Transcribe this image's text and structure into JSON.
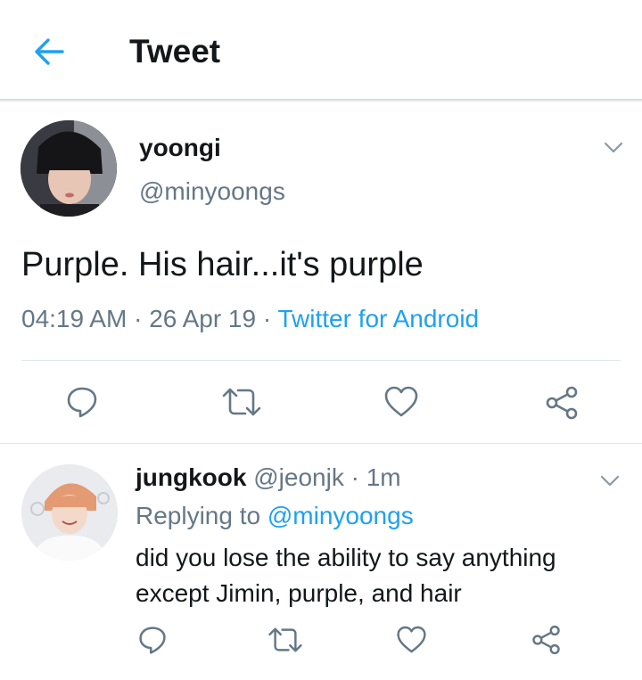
{
  "header": {
    "title": "Tweet",
    "back_icon": "arrow-left-icon",
    "accent_color": "#1da1f2"
  },
  "tweet": {
    "display_name": "yoongi",
    "handle": "@minyoongs",
    "text": "Purple. His hair...it's purple",
    "time": "04:19 AM",
    "date": "26 Apr 19",
    "separator": "·",
    "source": "Twitter for Android",
    "actions": [
      "reply-icon",
      "retweet-icon",
      "like-icon",
      "share-icon"
    ]
  },
  "reply": {
    "display_name": "jungkook",
    "handle": "@jeonjk",
    "separator": "·",
    "age": "1m",
    "replying_prefix": "Replying to",
    "replying_to": "@minyoongs",
    "text": "did you lose the ability to say anything except Jimin, purple, and hair",
    "actions": [
      "reply-icon",
      "retweet-icon",
      "like-icon",
      "share-icon"
    ]
  },
  "colors": {
    "text": "#14171a",
    "secondary": "#657786",
    "link": "#1da1f2",
    "divider": "#e1e8ed"
  }
}
